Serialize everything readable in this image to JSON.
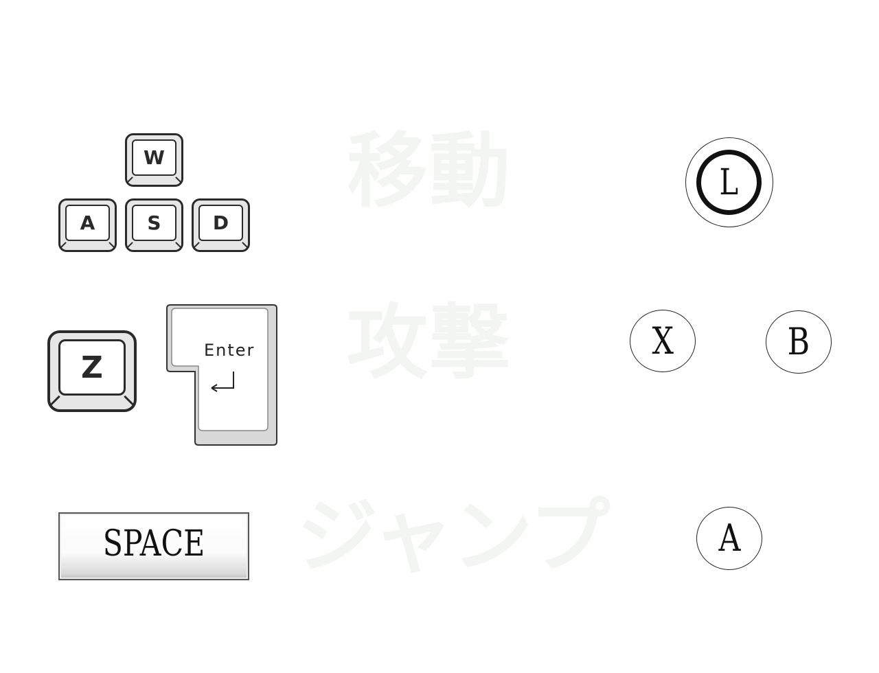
{
  "actions": {
    "move": "移動",
    "attack": "攻撃",
    "jump": "ジャンプ"
  },
  "keyboard": {
    "move_keys": [
      "W",
      "A",
      "S",
      "D"
    ],
    "attack_key": "Z",
    "enter_key": "Enter",
    "jump_key": "SPACE"
  },
  "controller": {
    "move_stick": "L",
    "attack_buttons": [
      "X",
      "B"
    ],
    "jump_button": "A"
  },
  "icons": {
    "enter_arrow": "return-arrow-icon"
  },
  "colors": {
    "background": "#ffffff",
    "action_label": "#f3f5f3",
    "key_outline": "#2a2a2a"
  }
}
